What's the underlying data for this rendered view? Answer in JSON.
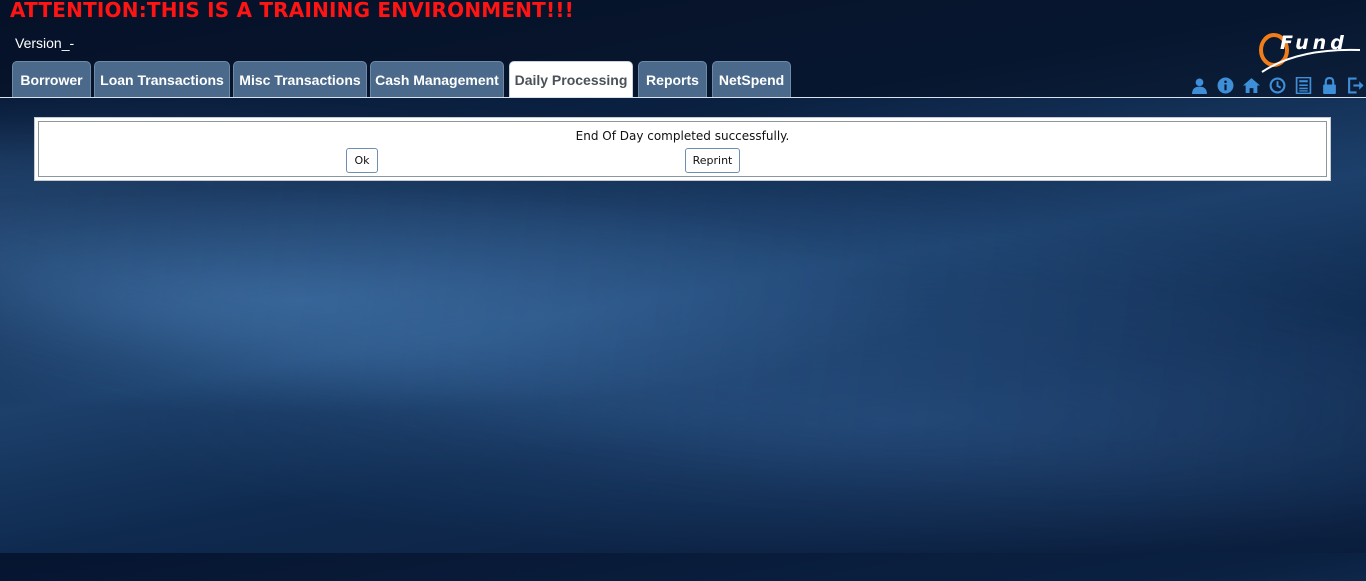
{
  "banner": {
    "attention": "ATTENTION:THIS IS A TRAINING ENVIRONMENT!!!"
  },
  "header": {
    "version": "Version_-",
    "logo_text": "Fund"
  },
  "tabs": [
    {
      "label": "Borrower",
      "active": false
    },
    {
      "label": "Loan Transactions",
      "active": false
    },
    {
      "label": "Misc Transactions",
      "active": false
    },
    {
      "label": "Cash Management",
      "active": false
    },
    {
      "label": "Daily Processing",
      "active": true
    },
    {
      "label": "Reports",
      "active": false
    },
    {
      "label": "NetSpend",
      "active": false
    }
  ],
  "toolbar_icons": [
    "user-icon",
    "info-icon",
    "home-icon",
    "clock-icon",
    "calculator-icon",
    "lock-icon",
    "logout-icon"
  ],
  "dialog": {
    "message": "End Of Day completed successfully.",
    "ok_label": "Ok",
    "reprint_label": "Reprint"
  },
  "colors": {
    "attention": "#ff1414",
    "tab_bg": "#4b6a8b",
    "tab_active_bg": "#ffffff",
    "icon": "#3f8fd8",
    "logo_accent": "#f07d1a"
  }
}
